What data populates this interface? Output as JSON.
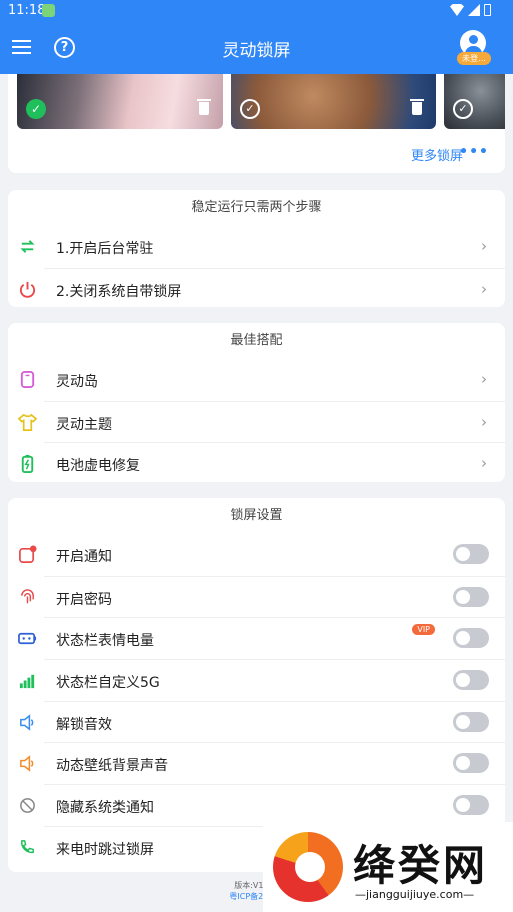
{
  "status_bar": {
    "time": "11:18"
  },
  "app_bar": {
    "title": "灵动锁屏",
    "login_badge": "未登..."
  },
  "wallpapers": {
    "more_label": "更多锁屏",
    "more_dots": "•••"
  },
  "steps_card": {
    "title": "稳定运行只需两个步骤",
    "items": [
      {
        "label": "1.开启后台常驻",
        "icon": "refresh-icon"
      },
      {
        "label": "2.关闭系统自带锁屏",
        "icon": "power-icon"
      }
    ]
  },
  "best_card": {
    "title": "最佳搭配",
    "items": [
      {
        "label": "灵动岛",
        "icon": "phone-icon"
      },
      {
        "label": "灵动主题",
        "icon": "tshirt-icon"
      },
      {
        "label": "电池虚电修复",
        "icon": "battery-icon"
      }
    ]
  },
  "settings_card": {
    "title": "锁屏设置",
    "items": [
      {
        "label": "开启通知",
        "icon": "notification-icon",
        "on": false
      },
      {
        "label": "开启密码",
        "icon": "fingerprint-icon",
        "on": false
      },
      {
        "label": "状态栏表情电量",
        "icon": "battery-face-icon",
        "on": false,
        "badge": "VIP"
      },
      {
        "label": "状态栏自定义5G",
        "icon": "signal-5g-icon",
        "on": false
      },
      {
        "label": "解锁音效",
        "icon": "speaker-icon",
        "on": false
      },
      {
        "label": "动态壁纸背景声音",
        "icon": "speaker-orange-icon",
        "on": false
      },
      {
        "label": "隐藏系统类通知",
        "icon": "hide-icon",
        "on": false
      },
      {
        "label": "来电时跳过锁屏",
        "icon": "phone-call-icon",
        "on": false
      }
    ]
  },
  "footer": {
    "version": "版本:V1.8.6",
    "icp": "粤ICP备20211"
  },
  "watermark": {
    "title": "绛癸网",
    "url": "—jiangguijiuye.com—"
  },
  "colors": {
    "primary": "#2f86f6",
    "toggle_off": "#c7cbd1",
    "vip": "#f56a3b"
  }
}
